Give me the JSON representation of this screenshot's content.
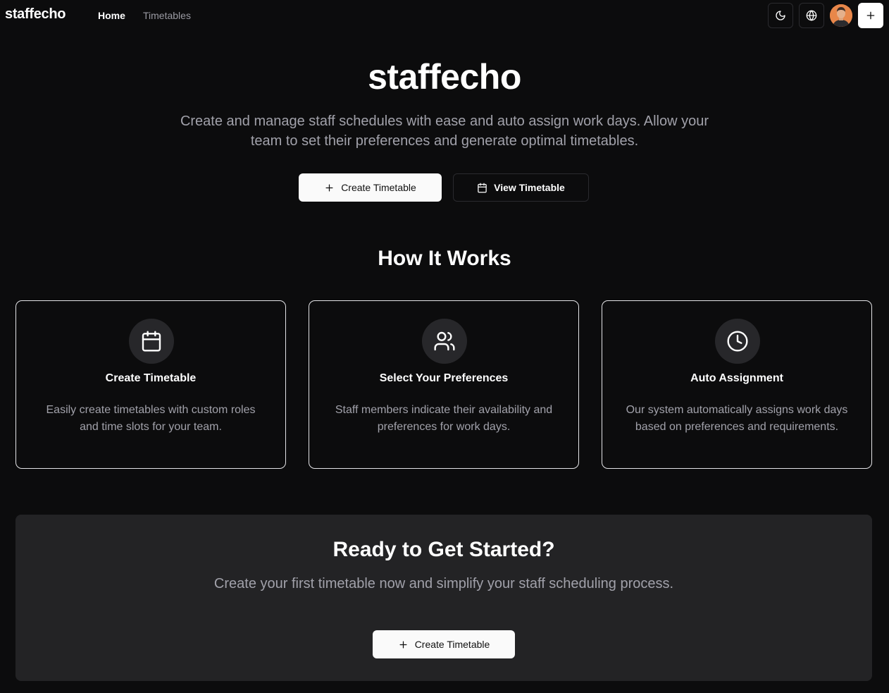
{
  "nav": {
    "brand": "staffecho",
    "links": [
      {
        "label": "Home",
        "active": true
      },
      {
        "label": "Timetables",
        "active": false
      }
    ],
    "icons": [
      "moon-icon",
      "globe-icon",
      "avatar",
      "plus-icon"
    ]
  },
  "hero": {
    "title": "staffecho",
    "subtitle": "Create and manage staff schedules with ease and auto assign work days. Allow your team to set their preferences and generate optimal timetables.",
    "primary_button": "Create Timetable",
    "secondary_button": "View Timetable"
  },
  "how_it_works": {
    "title": "How It Works",
    "cards": [
      {
        "icon": "calendar-icon",
        "title": "Create Timetable",
        "description": "Easily create timetables with custom roles and time slots for your team."
      },
      {
        "icon": "users-icon",
        "title": "Select Your Preferences",
        "description": "Staff members indicate their availability and preferences for work days."
      },
      {
        "icon": "clock-icon",
        "title": "Auto Assignment",
        "description": "Our system automatically assigns work days based on preferences and requirements."
      }
    ]
  },
  "cta": {
    "title": "Ready to Get Started?",
    "subtitle": "Create your first timetable now and simplify your staff scheduling process.",
    "button": "Create Timetable"
  },
  "colors": {
    "background": "#0c0c0d",
    "panel": "#232325",
    "muted_text": "#a1a1aa",
    "primary_button": "#fafafa"
  }
}
